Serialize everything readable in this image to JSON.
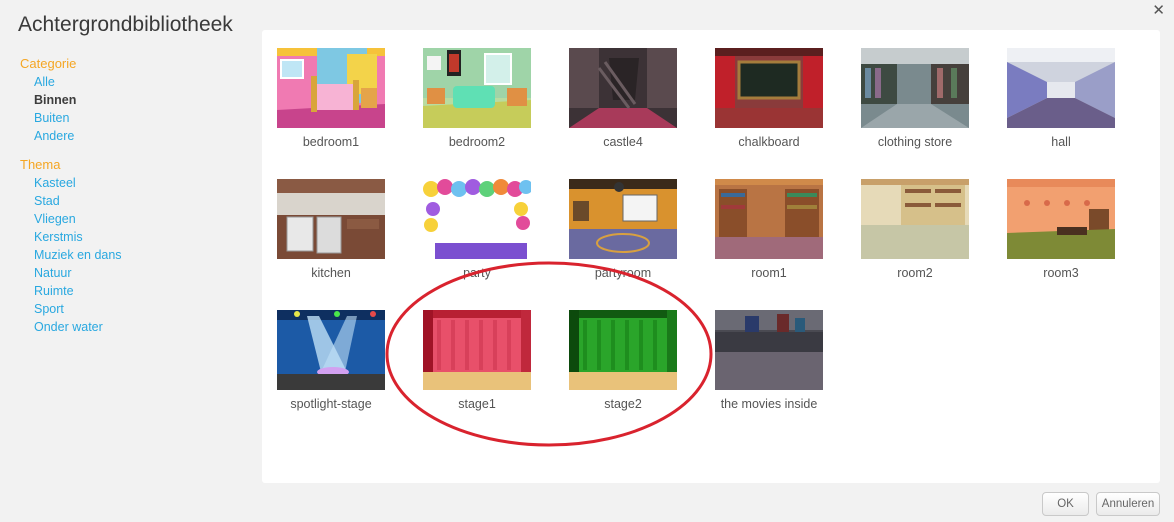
{
  "dialog": {
    "title": "Achtergrondbibliotheek",
    "close_icon": "close-icon"
  },
  "sidebar": {
    "category_title": "Categorie",
    "categories": [
      "Alle",
      "Binnen",
      "Buiten",
      "Andere"
    ],
    "active_category": "Binnen",
    "theme_title": "Thema",
    "themes": [
      "Kasteel",
      "Stad",
      "Vliegen",
      "Kerstmis",
      "Muziek en dans",
      "Natuur",
      "Ruimte",
      "Sport",
      "Onder water"
    ]
  },
  "backdrops": [
    "bedroom1",
    "bedroom2",
    "castle4",
    "chalkboard",
    "clothing store",
    "hall",
    "kitchen",
    "party",
    "partyroom",
    "room1",
    "room2",
    "room3",
    "spotlight-stage",
    "stage1",
    "stage2",
    "the movies inside"
  ],
  "buttons": {
    "ok": "OK",
    "cancel": "Annuleren"
  },
  "colors": {
    "accent_orange": "#f5a623",
    "link_blue": "#29a8e0",
    "annotation_red": "#d9232e"
  }
}
